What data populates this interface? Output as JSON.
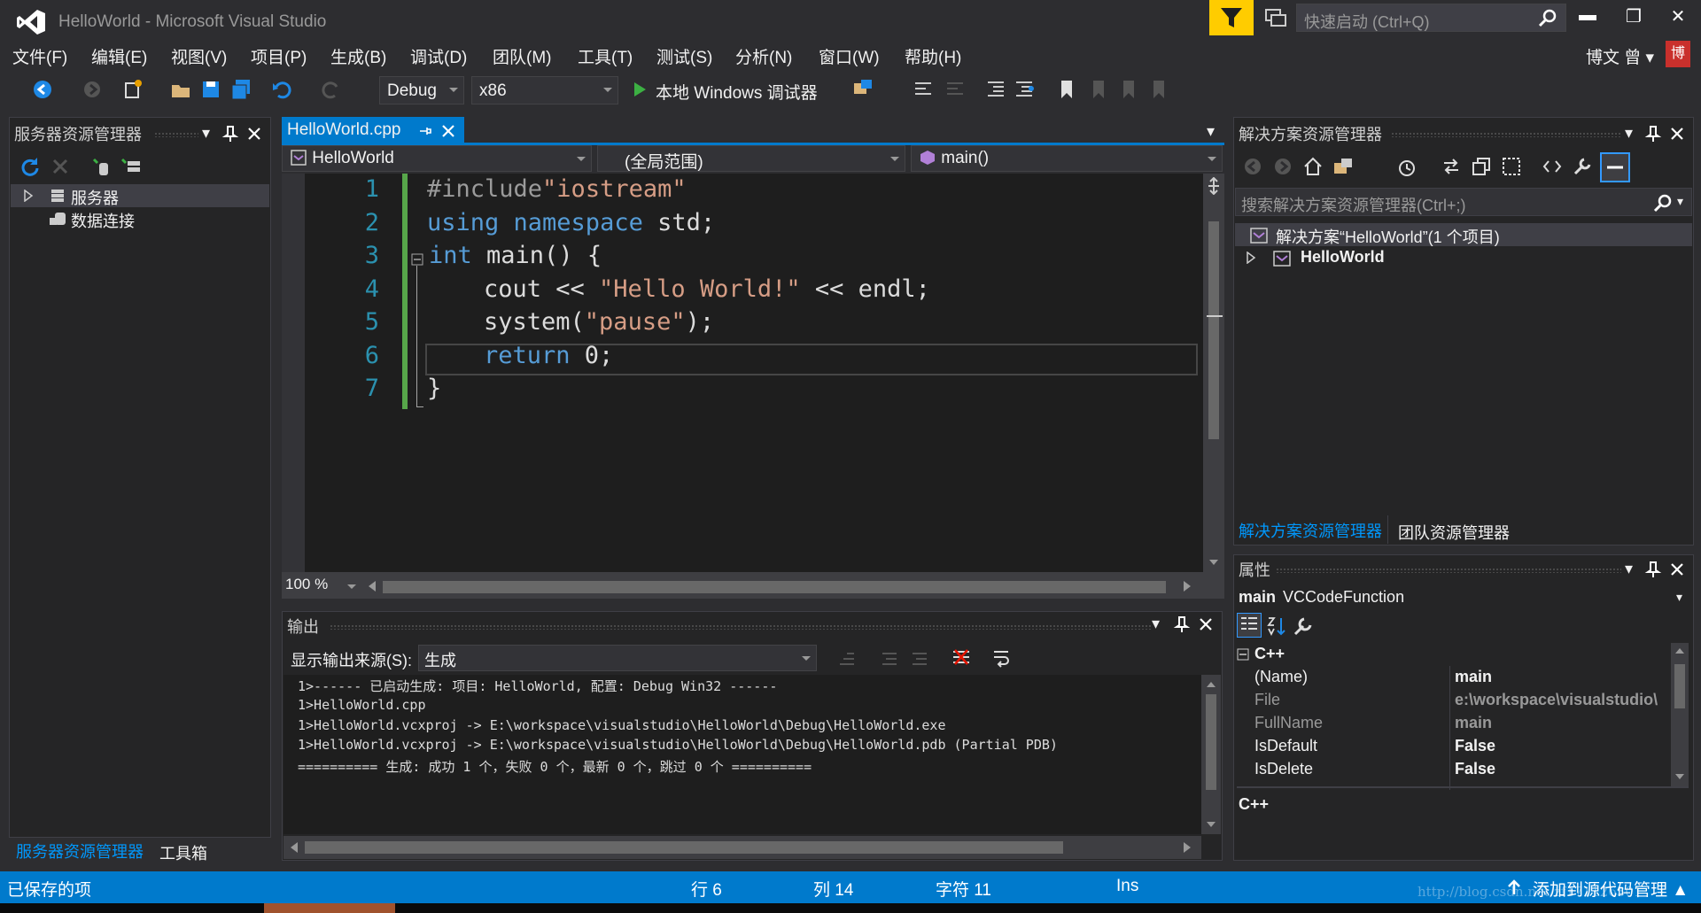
{
  "window": {
    "title": "HelloWorld - Microsoft Visual Studio",
    "quick_launch_placeholder": "快速启动 (Ctrl+Q)",
    "minimize": "▬",
    "restore": "❐",
    "close": "✕"
  },
  "menu": {
    "items": [
      "文件(F)",
      "编辑(E)",
      "视图(V)",
      "项目(P)",
      "生成(B)",
      "调试(D)",
      "团队(M)",
      "工具(T)",
      "测试(S)",
      "分析(N)",
      "窗口(W)",
      "帮助(H)"
    ]
  },
  "user": {
    "name": "博文 曾 ▾",
    "avatar": "博"
  },
  "toolbar": {
    "config": "Debug",
    "platform": "x86",
    "run_label": "本地 Windows 调试器"
  },
  "server_explorer": {
    "title": "服务器资源管理器",
    "items": [
      "服务器",
      "数据连接"
    ],
    "bottom_tabs": [
      "服务器资源管理器",
      "工具箱"
    ]
  },
  "editor": {
    "tab": "HelloWorld.cpp",
    "project_combo": "HelloWorld",
    "scope_combo": "(全局范围)",
    "member_combo": "main()",
    "zoom": "100 %",
    "line_numbers": [
      "1",
      "2",
      "3",
      "4",
      "5",
      "6",
      "7"
    ],
    "code": {
      "l1_pp": "#include",
      "l1_str": "\"iostream\"",
      "l2_kw": "using namespace",
      "l2_rest": " std;",
      "l3_kw": "int",
      "l3_rest": " main() {",
      "l4_a": "cout << ",
      "l4_str": "\"Hello World!\"",
      "l4_b": " << endl;",
      "l5_a": "system(",
      "l5_str": "\"pause\"",
      "l5_b": ");",
      "l6_kw": "return",
      "l6_rest": " 0;",
      "l7": "}"
    }
  },
  "output": {
    "title": "输出",
    "source_label": "显示输出来源(S):",
    "source_value": "生成",
    "lines": [
      "1>------ 已启动生成: 项目: HelloWorld, 配置: Debug Win32 ------",
      "1>HelloWorld.cpp",
      "1>HelloWorld.vcxproj -> E:\\workspace\\visualstudio\\HelloWorld\\Debug\\HelloWorld.exe",
      "1>HelloWorld.vcxproj -> E:\\workspace\\visualstudio\\HelloWorld\\Debug\\HelloWorld.pdb (Partial PDB)",
      "========== 生成: 成功 1 个，失败 0 个，最新 0 个，跳过 0 个 =========="
    ]
  },
  "solution_explorer": {
    "title": "解决方案资源管理器",
    "search_placeholder": "搜索解决方案资源管理器(Ctrl+;)",
    "solution_label": "解决方案“HelloWorld”(1 个项目)",
    "project_label": "HelloWorld",
    "bottom_tabs": [
      "解决方案资源管理器",
      "团队资源管理器"
    ]
  },
  "properties": {
    "title": "属性",
    "object_name": "main",
    "object_type": "VCCodeFunction",
    "category": "C++",
    "rows": [
      {
        "name": "(Name)",
        "value": "main"
      },
      {
        "name": "File",
        "value": "e:\\workspace\\visualstudio\\"
      },
      {
        "name": "FullName",
        "value": "main"
      },
      {
        "name": "IsDefault",
        "value": "False"
      },
      {
        "name": "IsDelete",
        "value": "False"
      }
    ],
    "description": "C++"
  },
  "statusbar": {
    "saved": "已保存的项",
    "line": "行 6",
    "col": "列 14",
    "char": "字符 11",
    "ins": "Ins",
    "source_control": "添加到源代码管理 ▲",
    "watermark": "http://blog.csdn.net/zf171126301"
  }
}
